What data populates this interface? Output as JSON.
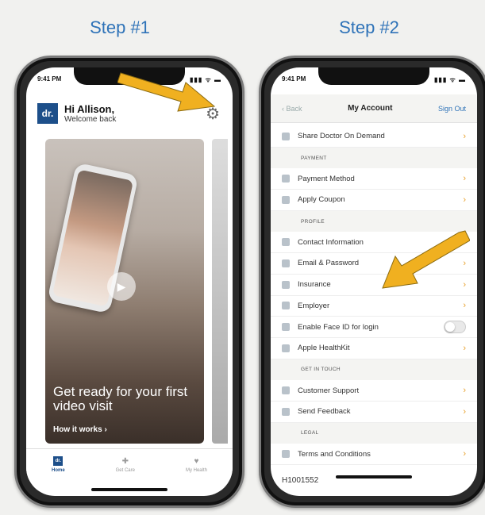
{
  "steps": {
    "step1": "Step #1",
    "step2": "Step #2"
  },
  "phone1": {
    "status_time": "9:41 PM",
    "greeting_name": "Hi Allison,",
    "greeting_sub": "Welcome back",
    "logo": "dr.",
    "card_text": "Get ready for your first video visit",
    "card_link": "How it works",
    "tabs": [
      {
        "label": "Home",
        "icon": "home-icon",
        "active": true
      },
      {
        "label": "Get Care",
        "icon": "medkit-icon"
      },
      {
        "label": "My Health",
        "icon": "heart-icon"
      }
    ]
  },
  "phone2": {
    "status_time": "9:41 PM",
    "nav": {
      "back": "Back",
      "title": "My Account",
      "sign_out": "Sign Out"
    },
    "items": [
      {
        "type": "row",
        "label": "Share Doctor On Demand",
        "icon": "gift-icon"
      },
      {
        "type": "section",
        "label": "PAYMENT"
      },
      {
        "type": "row",
        "label": "Payment Method",
        "icon": "card-icon"
      },
      {
        "type": "row",
        "label": "Apply Coupon",
        "icon": "tag-icon"
      },
      {
        "type": "section",
        "label": "PROFILE"
      },
      {
        "type": "row",
        "label": "Contact Information",
        "icon": "contact-icon"
      },
      {
        "type": "row",
        "label": "Email & Password",
        "icon": "mail-icon"
      },
      {
        "type": "row",
        "label": "Insurance",
        "icon": "insurance-icon"
      },
      {
        "type": "row",
        "label": "Employer",
        "icon": "briefcase-icon"
      },
      {
        "type": "toggle",
        "label": "Enable Face ID for login",
        "icon": "faceid-icon",
        "on": false
      },
      {
        "type": "row",
        "label": "Apple HealthKit",
        "icon": "heart-icon"
      },
      {
        "type": "section",
        "label": "GET IN TOUCH"
      },
      {
        "type": "row",
        "label": "Customer Support",
        "icon": "support-icon"
      },
      {
        "type": "row",
        "label": "Send Feedback",
        "icon": "chat-icon"
      },
      {
        "type": "section",
        "label": "LEGAL"
      },
      {
        "type": "row",
        "label": "Terms and Conditions",
        "icon": "document-icon"
      }
    ],
    "footer_code": "H1001552"
  },
  "colors": {
    "accent": "#e8a02a",
    "brand": "#1d4f8a",
    "step_title": "#2f73b8",
    "arrow": "#f0b020"
  }
}
